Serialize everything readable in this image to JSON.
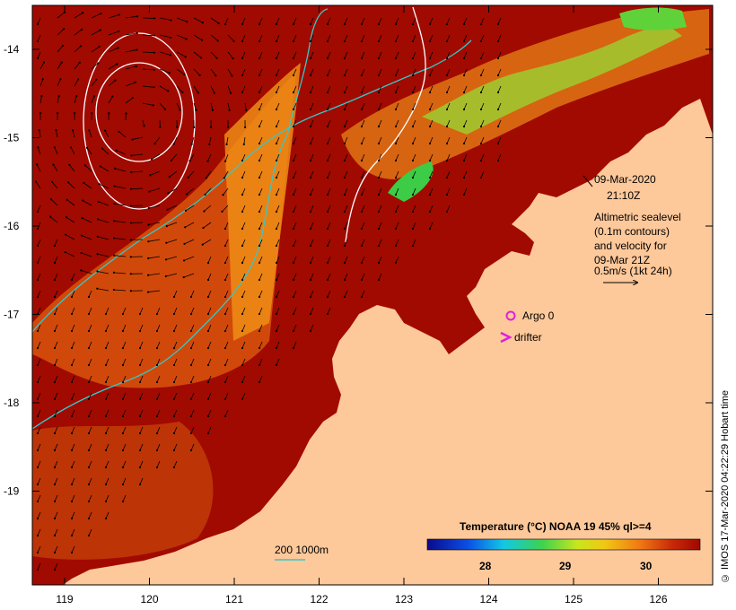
{
  "map": {
    "title_date": "09-Mar-2020",
    "title_time": "21:10Z",
    "legend_lines": [
      "Altimetric sealevel",
      "(0.1m contours)",
      "and velocity for",
      "09-Mar 21Z",
      "0.5m/s (1kt 24h)"
    ],
    "argo_label": "Argo 0",
    "drifter_label": "drifter",
    "colorbar_title": "Temperature (°C) NOAA 19 45% ql>=4",
    "colorbar_ticks": [
      "28",
      "29",
      "30"
    ],
    "bathy_label": "200  1000m",
    "credit": "© IMOS 17-Mar-2020 04:22:29 Hobart time",
    "lat_labels": [
      "-14",
      "-15",
      "-16",
      "-17",
      "-18",
      "-19"
    ],
    "lon_labels": [
      "119",
      "120",
      "121",
      "122",
      "123",
      "124",
      "125",
      "126"
    ],
    "colors": {
      "land": "#fdc89a",
      "sea_warm": "#a10a00",
      "sea_mid": "#d7430a",
      "sea_orange": "#f08c14",
      "sea_green": "#5fd23a",
      "contour": "#ffffff",
      "isobath": "#35c8c8",
      "argo": "#e020e0",
      "drifter": "#e020e0"
    }
  }
}
